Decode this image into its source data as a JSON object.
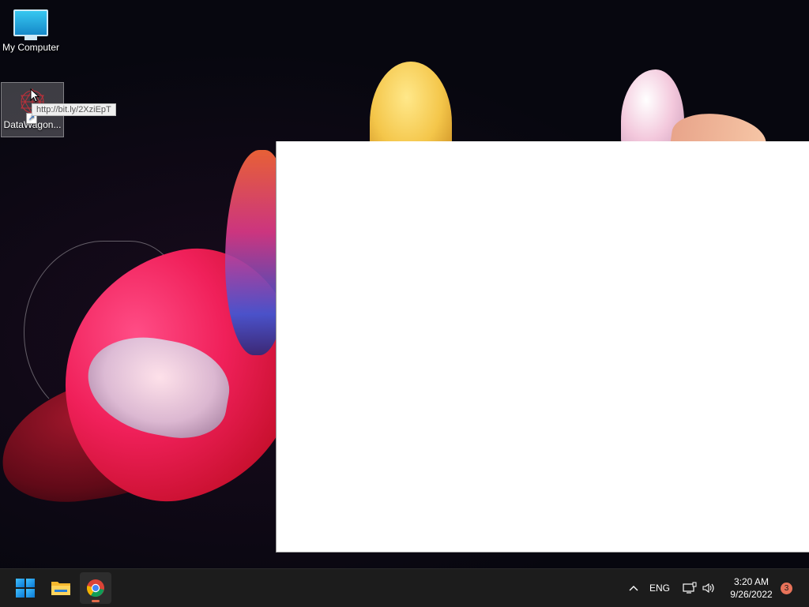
{
  "desktop": {
    "icons": [
      {
        "label": "My Computer",
        "icon": "computer-icon"
      },
      {
        "label": "DataWagon...",
        "icon": "datawagon-shortcut-icon"
      }
    ],
    "tooltip": "http://bit.ly/2XziEpT"
  },
  "taskbar": {
    "apps": [
      {
        "name": "Start",
        "icon": "windows-start-icon"
      },
      {
        "name": "File Explorer",
        "icon": "folder-icon"
      },
      {
        "name": "Google Chrome",
        "icon": "chrome-icon",
        "active": true
      }
    ],
    "tray": {
      "language": "ENG",
      "time": "3:20 AM",
      "date": "9/26/2022",
      "notification_count": "3"
    }
  },
  "colors": {
    "taskbar_bg": "#1c1c1c",
    "notification_badge": "#e8735a",
    "window_bg": "#ffffff"
  }
}
